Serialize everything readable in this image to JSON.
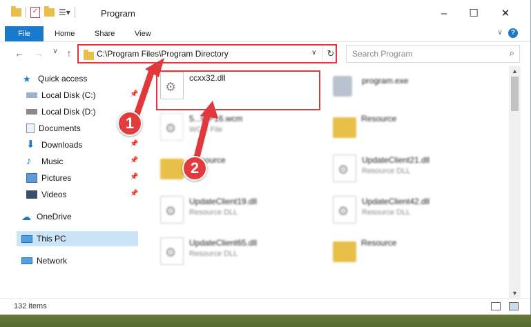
{
  "window": {
    "title": "Program",
    "controls": [
      "–",
      "☐",
      "✕"
    ]
  },
  "ribbon": {
    "tabs": [
      "File",
      "Home",
      "Share",
      "View"
    ]
  },
  "navigation": {
    "address": "C:\\Program Files\\Program Directory",
    "search_placeholder": "Search Program"
  },
  "sidebar": {
    "items": [
      {
        "label": "Quick access",
        "icon": "star-icon"
      },
      {
        "label": "Local Disk (C:)",
        "icon": "drive-icon",
        "pinned": true
      },
      {
        "label": "Local Disk (D:)",
        "icon": "drive-icon"
      },
      {
        "label": "Documents",
        "icon": "documents-icon",
        "pinned": true
      },
      {
        "label": "Downloads",
        "icon": "download-icon",
        "pinned": true
      },
      {
        "label": "Music",
        "icon": "music-icon",
        "pinned": true
      },
      {
        "label": "Pictures",
        "icon": "pictures-icon",
        "pinned": true
      },
      {
        "label": "Videos",
        "icon": "videos-icon",
        "pinned": true
      },
      {
        "label": "OneDrive",
        "icon": "cloud-icon"
      },
      {
        "label": "This PC",
        "icon": "monitor-icon",
        "selected": true
      },
      {
        "label": "Network",
        "icon": "network-icon"
      }
    ]
  },
  "files": [
    {
      "name": "ccxx32.dll",
      "type": "",
      "icon": "dll-icon",
      "highlighted": true
    },
    {
      "name": "program.exe",
      "type": "",
      "icon": "exe-icon"
    },
    {
      "name": "5...WP16.wcm",
      "type": "WCM File",
      "icon": "file-icon"
    },
    {
      "name": "Resource",
      "type": "",
      "icon": "folder-icon"
    },
    {
      "name": "...esource",
      "type": "",
      "icon": "folder-icon"
    },
    {
      "name": "UpdateClient21.dll",
      "type": "Resource DLL",
      "icon": "dll-icon"
    },
    {
      "name": "UpdateClient19.dll",
      "type": "Resource DLL",
      "icon": "dll-icon"
    },
    {
      "name": "UpdateClient42.dll",
      "type": "Resource DLL",
      "icon": "dll-icon"
    },
    {
      "name": "UpdateClient65.dll",
      "type": "Resource DLL",
      "icon": "dll-icon"
    },
    {
      "name": "Resource",
      "type": "",
      "icon": "folder-icon"
    }
  ],
  "status": {
    "item_count": "132 items"
  },
  "annotations": {
    "callout_1": "1",
    "callout_2": "2",
    "color": "#e0383c"
  }
}
